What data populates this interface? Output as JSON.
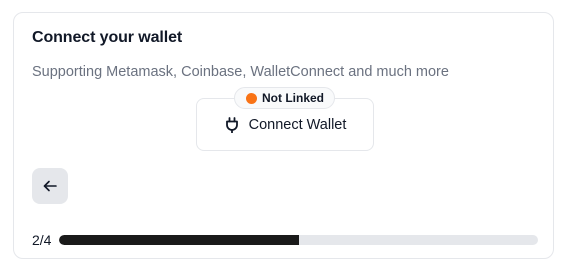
{
  "card": {
    "title": "Connect your wallet",
    "subtitle": "Supporting Metamask, Coinbase, WalletConnect and much more"
  },
  "wallet": {
    "status_label": "Not Linked",
    "status_color": "#f97316",
    "connect_label": "Connect Wallet",
    "connect_icon": "plug-icon"
  },
  "navigation": {
    "back_icon": "arrow-left-icon"
  },
  "progress": {
    "counter_text": "2/4",
    "fraction": 0.5
  }
}
